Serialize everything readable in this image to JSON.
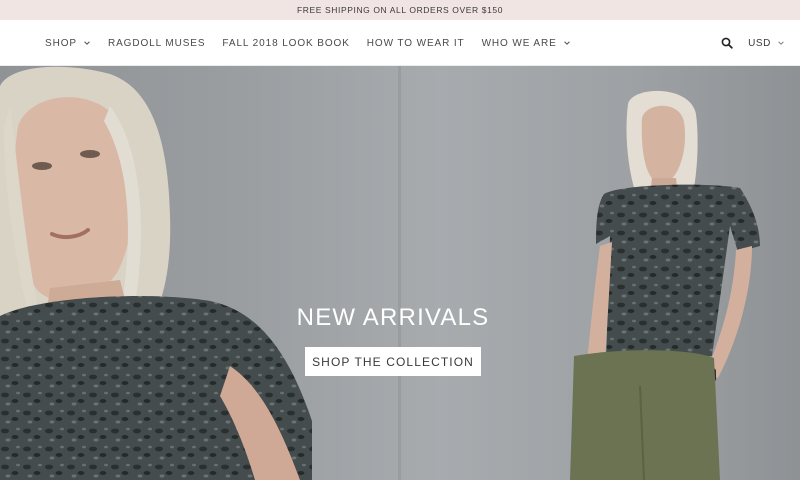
{
  "announcement": {
    "text": "FREE SHIPPING ON ALL ORDERS OVER $150"
  },
  "nav": {
    "items": [
      {
        "label": "SHOP",
        "has_dropdown": true
      },
      {
        "label": "RAGDOLL MUSES",
        "has_dropdown": false
      },
      {
        "label": "FALL 2018 LOOK BOOK",
        "has_dropdown": false
      },
      {
        "label": "HOW TO WEAR IT",
        "has_dropdown": false
      },
      {
        "label": "WHO WE ARE",
        "has_dropdown": true
      }
    ],
    "search_icon": "search-icon",
    "currency": "USD"
  },
  "hero": {
    "title": "NEW ARRIVALS",
    "cta_label": "SHOP THE COLLECTION"
  },
  "colors": {
    "announcement_bg": "#f1e5e4",
    "hero_bg": "#9ea2a5",
    "cta_bg": "#ffffff"
  }
}
